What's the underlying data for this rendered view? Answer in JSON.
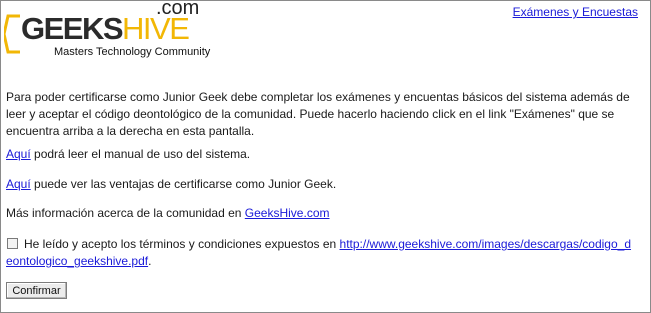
{
  "logo": {
    "geeks": "GEEKS",
    "hive": "HIVE",
    "dotcom": ".com",
    "tagline": "Masters Technology Community"
  },
  "header": {
    "link": "Exámenes y Encuestas"
  },
  "intro": "Para poder certificarse como Junior Geek debe completar los exámenes y encuentas básicos del sistema además de leer y aceptar el código deontológico de la comunidad. Puede hacerlo haciendo click en el link \"Exámenes\" que se encuentra arriba a la derecha en esta pantalla.",
  "manual": {
    "link": "Aquí",
    "text": " podrá leer el manual de uso del sistema."
  },
  "benefits": {
    "link": "Aquí",
    "text": " puede ver las ventajas de certificarse como Junior Geek."
  },
  "more_info": {
    "text": "Más información acerca de la comunidad en ",
    "link": "GeeksHive.com"
  },
  "terms": {
    "checked": false,
    "text": "He leído y acepto los términos y condiciones expuestos en ",
    "link": "http://www.geekshive.com/images/descargas/codigo_deontologico_geekshive.pdf",
    "suffix": "."
  },
  "confirm_button": "Confirmar",
  "colors": {
    "link": "#1a1ad8",
    "hive_accent": "#f2b705"
  }
}
